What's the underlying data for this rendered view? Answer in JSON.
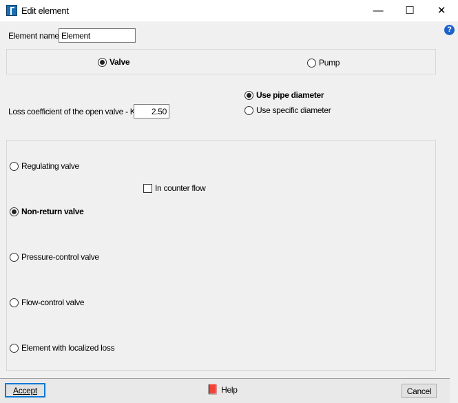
{
  "window": {
    "title": "Edit element",
    "minimize": "—",
    "maximize": "☐",
    "close": "✕"
  },
  "element_name": {
    "label": "Element name",
    "value": "Element"
  },
  "type": {
    "valve": "Valve",
    "pump": "Pump",
    "selected": "valve"
  },
  "loss": {
    "label": "Loss coefficient of the open valve - K",
    "value": "2.50"
  },
  "diameter": {
    "pipe": "Use pipe diameter",
    "specific": "Use specific diameter",
    "selected": "pipe"
  },
  "valve_types": {
    "regulating": "Regulating valve",
    "counter_flow": "In counter flow",
    "non_return": "Non-return valve",
    "pressure": "Pressure-control valve",
    "flow": "Flow-control valve",
    "localized": "Element with localized loss",
    "selected": "non_return"
  },
  "footer": {
    "accept": "Accept",
    "help": "Help",
    "cancel": "Cancel"
  },
  "help_icon": "?"
}
